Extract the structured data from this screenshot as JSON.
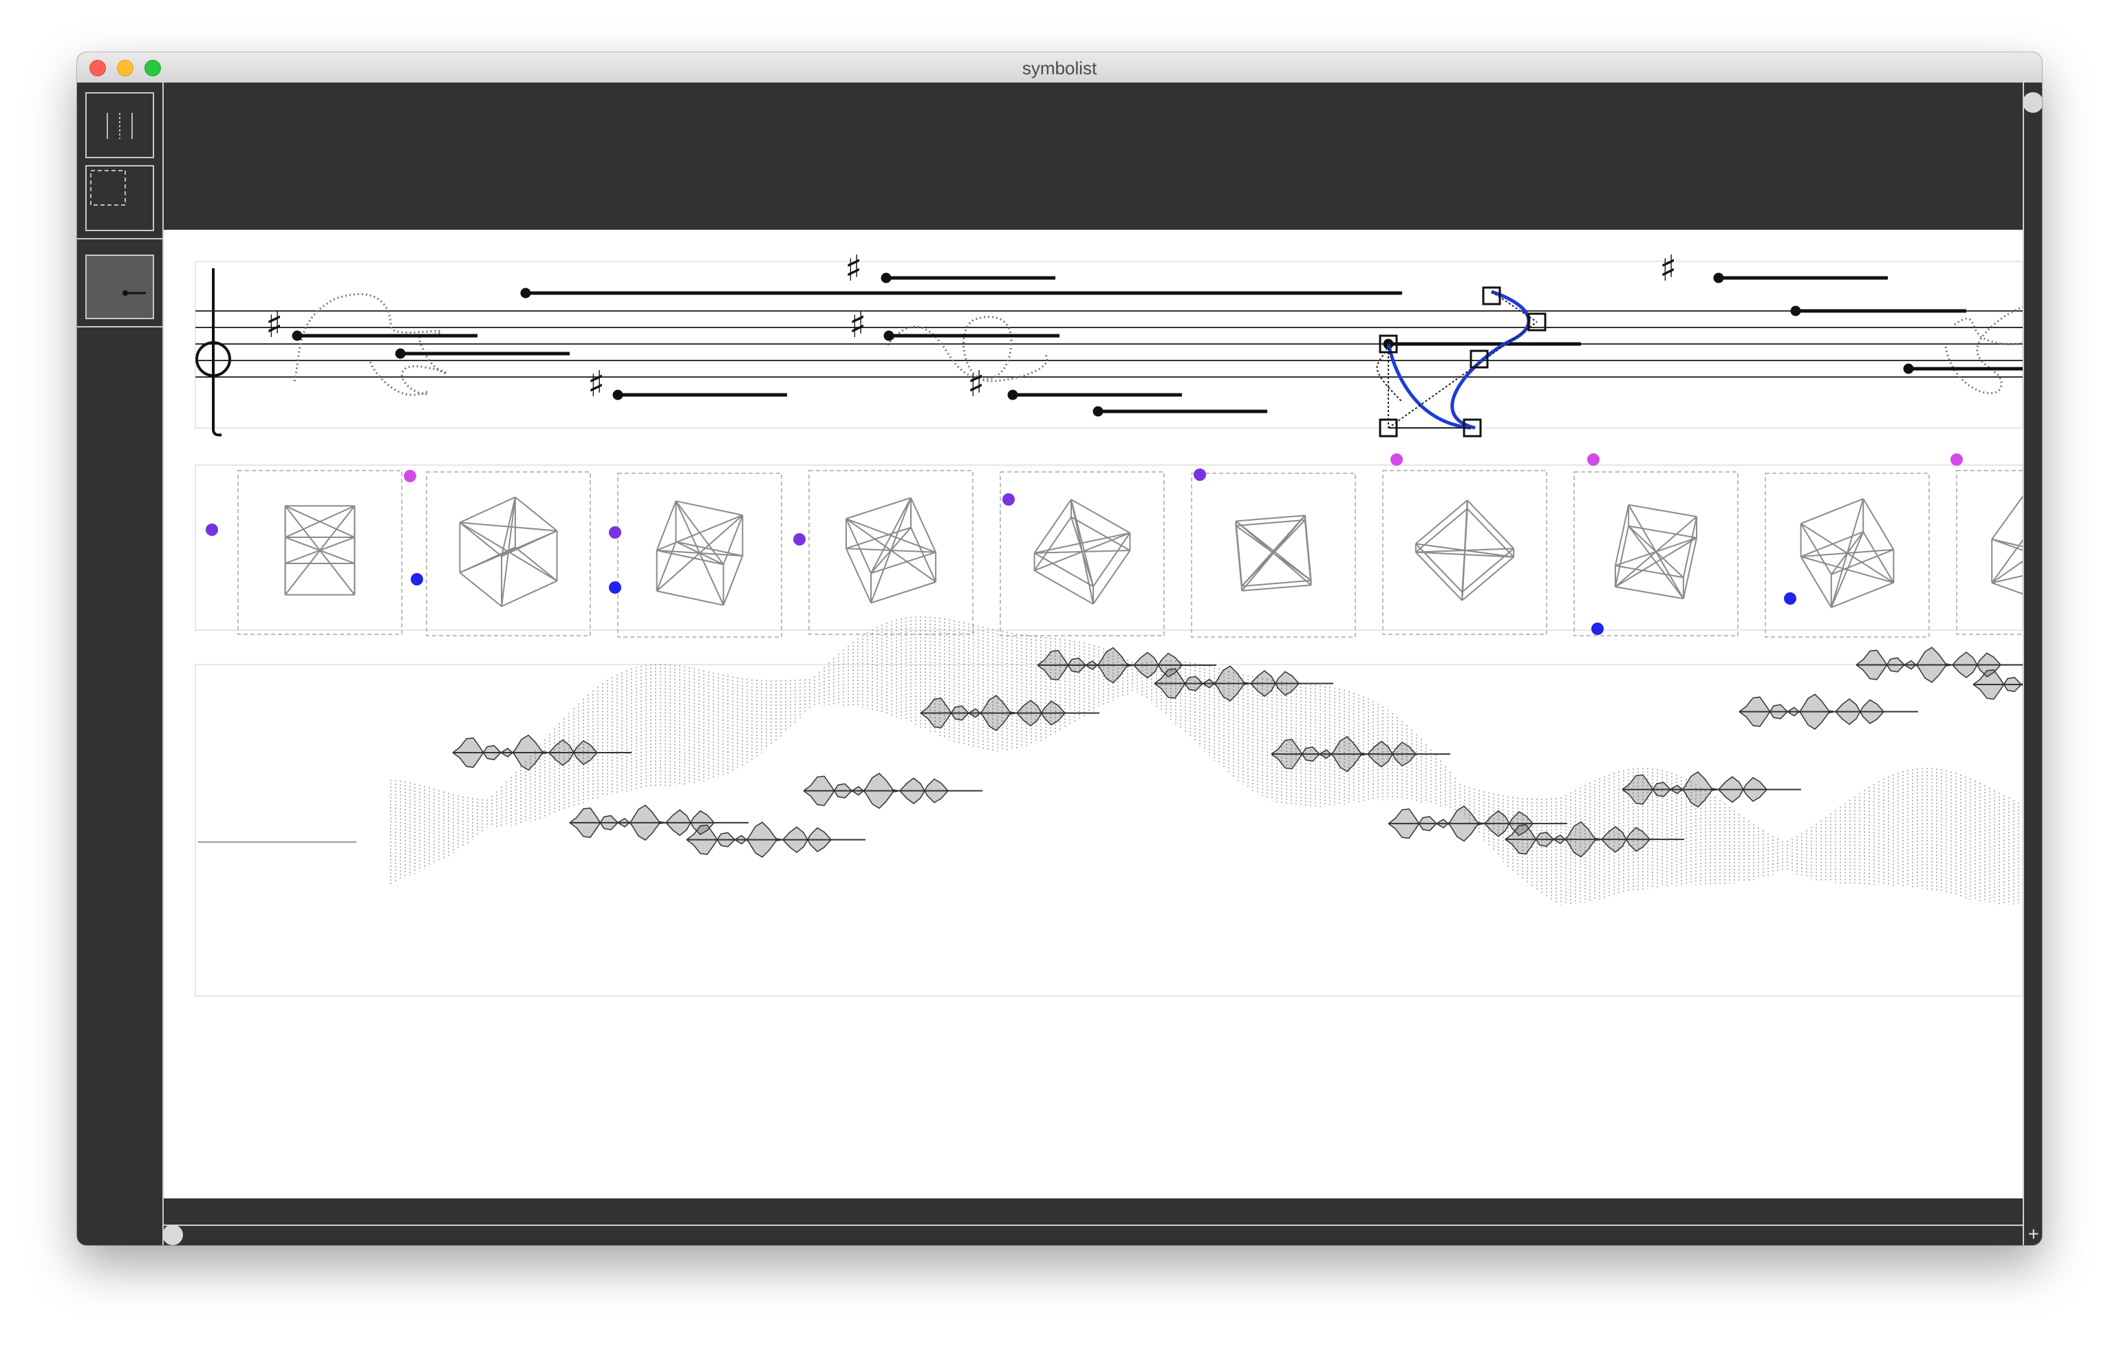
{
  "window": {
    "title": "symbolist"
  },
  "toolbar": {
    "tools": [
      {
        "icon": "staff-lines-icon"
      },
      {
        "icon": "dashed-selection-icon"
      }
    ],
    "palette": [
      {
        "icon": "note-line-icon"
      }
    ]
  },
  "score": {
    "staff": {
      "clef": "circle-clef-icon",
      "accidental": "♯"
    },
    "cube_row": {
      "cube_count": 10
    },
    "waveform_row": {}
  },
  "scroll": {
    "plus_label": "+"
  },
  "colors": {
    "background": "#323232",
    "sheet": "#ffffff",
    "accent_blue": "#1d3bd6",
    "dot_magenta": "#d24be6",
    "dot_purple": "#7a33e0",
    "dot_blue": "#2222ee"
  }
}
